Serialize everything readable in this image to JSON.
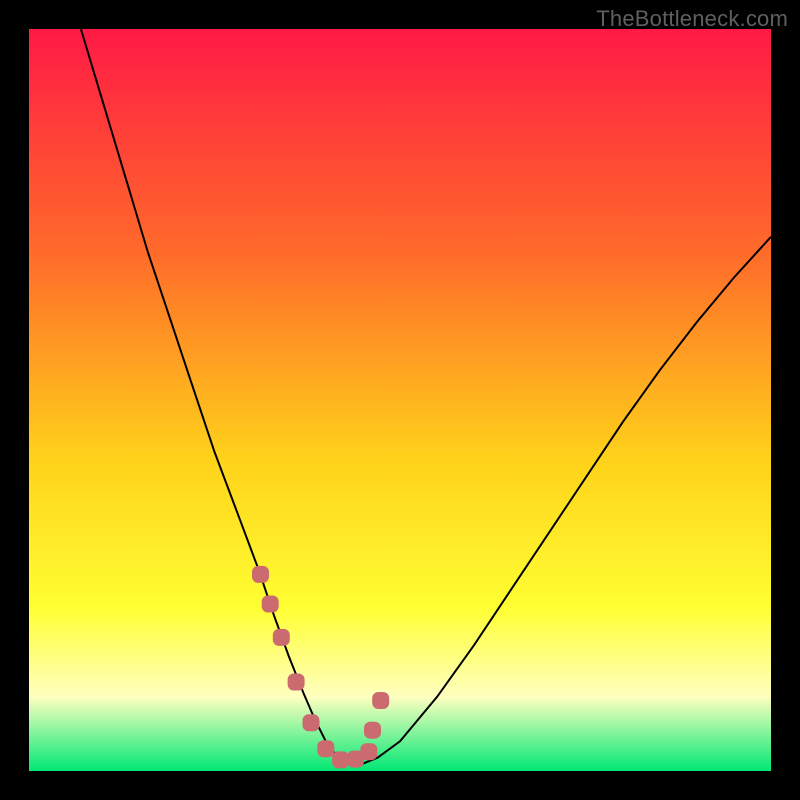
{
  "watermark": "TheBottleneck.com",
  "colors": {
    "frame": "#000000",
    "gradient_top": "#ff1a45",
    "gradient_mid1": "#ff6a2a",
    "gradient_mid2": "#ffd21a",
    "gradient_mid3": "#ffff33",
    "gradient_pale": "#ffffc0",
    "gradient_bottom": "#00e874",
    "curve": "#000000",
    "marker_fill": "#cc6b6f",
    "marker_stroke": "#cc6b6f"
  },
  "chart_data": {
    "type": "line",
    "title": "",
    "xlabel": "",
    "ylabel": "",
    "xlim": [
      0,
      100
    ],
    "ylim": [
      0,
      100
    ],
    "series": [
      {
        "name": "bottleneck-curve",
        "x": [
          7,
          10,
          13,
          16,
          19,
          22,
          25,
          28,
          31,
          33,
          35,
          37,
          38.5,
          40,
          41.5,
          43,
          45,
          47,
          50,
          55,
          60,
          65,
          70,
          75,
          80,
          85,
          90,
          95,
          100
        ],
        "y": [
          100,
          90,
          80,
          70,
          61,
          52,
          43,
          35,
          27,
          21,
          15.5,
          10.5,
          7,
          4,
          2,
          1,
          1,
          1.8,
          4,
          10,
          17,
          24.5,
          32,
          39.5,
          47,
          54,
          60.5,
          66.5,
          72
        ]
      }
    ],
    "markers": {
      "name": "highlighted-points",
      "x": [
        31.2,
        32.5,
        34,
        36,
        38,
        40,
        42,
        44,
        45.8,
        46.3,
        47.4
      ],
      "y": [
        26.5,
        22.5,
        18,
        12,
        6.5,
        3,
        1.5,
        1.6,
        2.6,
        5.5,
        9.5
      ]
    }
  }
}
